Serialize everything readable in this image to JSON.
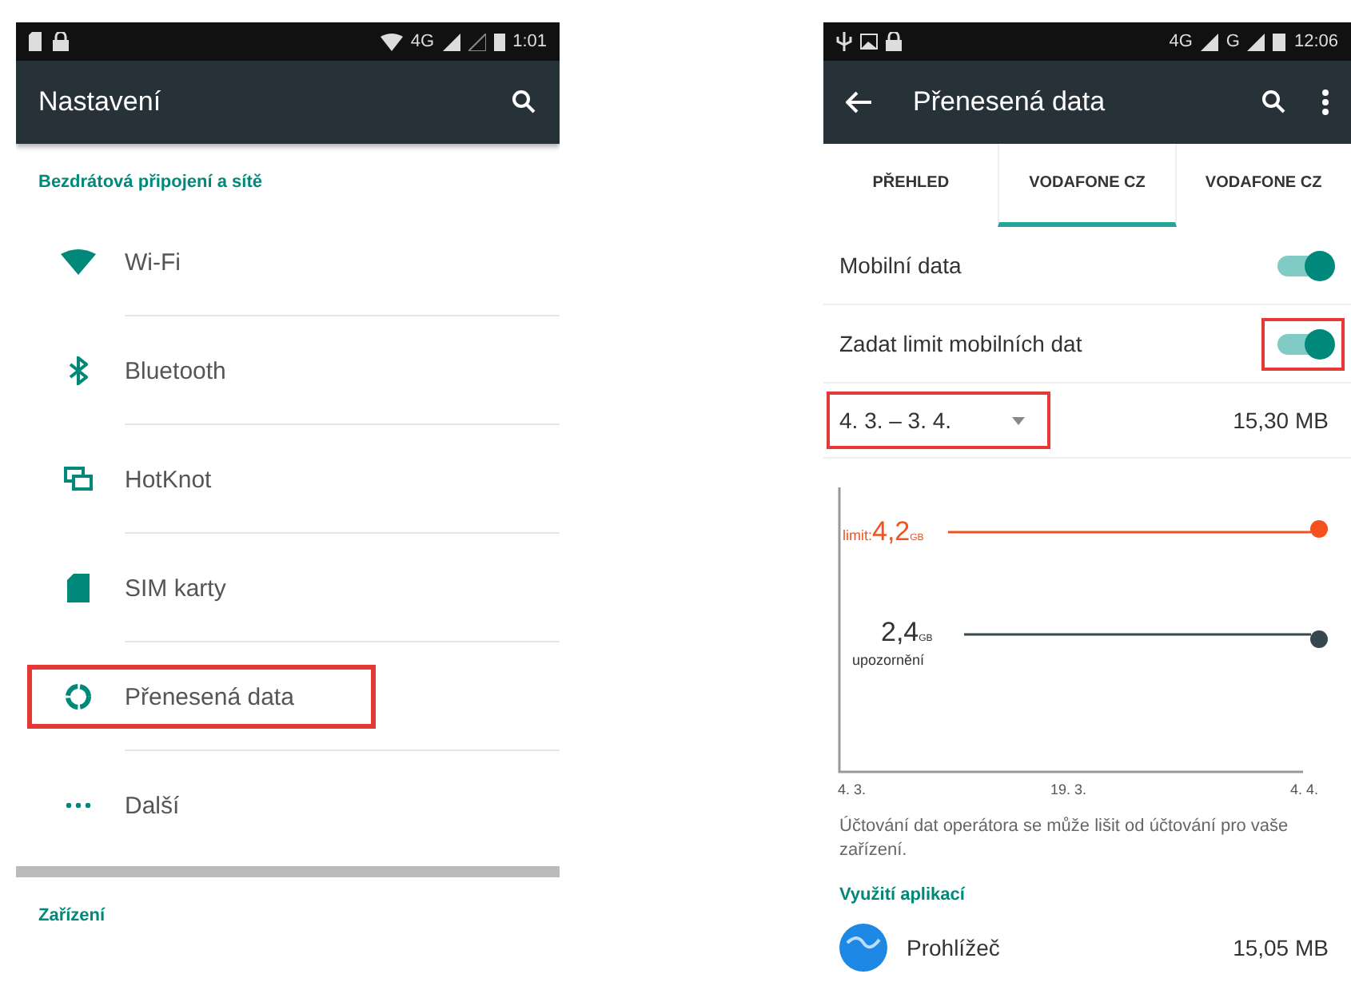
{
  "left_phone": {
    "status_bar": {
      "network": "4G",
      "time": "1:01"
    },
    "toolbar": {
      "title": "Nastavení"
    },
    "sections": [
      {
        "title": "Bezdrátová připojení a sítě",
        "items": [
          {
            "kind": "wifi",
            "label": "Wi-Fi",
            "highlighted": false
          },
          {
            "kind": "bluetooth",
            "label": "Bluetooth",
            "highlighted": false
          },
          {
            "kind": "hotknot",
            "label": "HotKnot",
            "highlighted": false
          },
          {
            "kind": "sim",
            "label": "SIM karty",
            "highlighted": false
          },
          {
            "kind": "data",
            "label": "Přenesená data",
            "highlighted": true
          },
          {
            "kind": "more",
            "label": "Další",
            "highlighted": false
          }
        ]
      },
      {
        "title": "Zařízení"
      }
    ]
  },
  "right_phone": {
    "status_bar": {
      "network": "4G",
      "network_2": "G",
      "time": "12:06"
    },
    "toolbar": {
      "title": "Přenesená data"
    },
    "tabs": [
      {
        "label": "PŘEHLED",
        "selected": false
      },
      {
        "label": "VODAFONE CZ",
        "selected": true
      },
      {
        "label": "VODAFONE CZ",
        "selected": false
      }
    ],
    "switches": [
      {
        "label": "Mobilní data",
        "on": true,
        "highlighted": false
      },
      {
        "label": "Zadat limit mobilních dat",
        "on": true,
        "highlighted": true
      }
    ],
    "period": {
      "value": "4. 3. – 3. 4.",
      "highlighted": true,
      "total": "15,30 MB"
    },
    "graph": {
      "limit": {
        "prefix": "limit:",
        "value": "4,2",
        "unit": "GB"
      },
      "warning": {
        "value": "2,4",
        "unit": "GB",
        "caption": "upozornění"
      },
      "x_labels": [
        "4. 3.",
        "19. 3.",
        "4. 4."
      ]
    },
    "note": "Účtování dat operátora se může lišit od účtování pro vaše zařízení.",
    "apps_header": "Využití aplikací",
    "apps": [
      {
        "name": "Prohlížeč",
        "usage": "15,05 MB"
      }
    ]
  }
}
